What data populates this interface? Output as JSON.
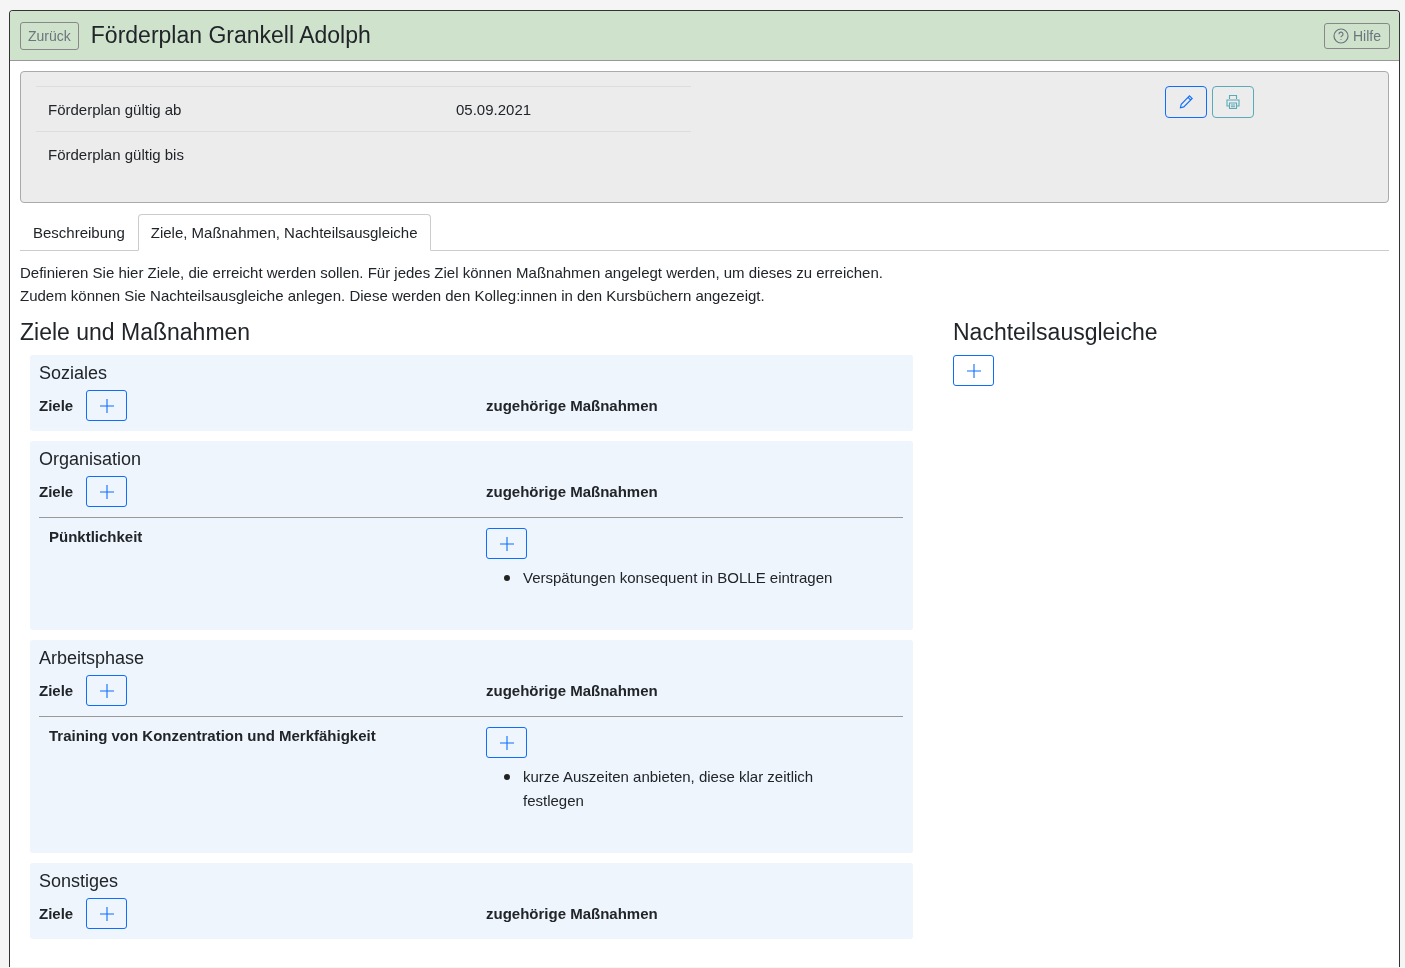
{
  "header": {
    "back_button": "Zurück",
    "title": "Förderplan Grankell Adolph",
    "help_button": "Hilfe"
  },
  "info": {
    "rows": [
      {
        "label": "Förderplan gültig ab",
        "value": "05.09.2021"
      },
      {
        "label": "Förderplan gültig bis"
      }
    ]
  },
  "tabs": [
    {
      "label": "Beschreibung",
      "selected": false
    },
    {
      "label": "Ziele, Maßnahmen, Nachteilsausgleiche",
      "selected": true
    }
  ],
  "intro": [
    "Definieren Sie hier Ziele, die erreicht werden sollen. Für jedes Ziel können Maßnahmen angelegt werden, um dieses zu erreichen.",
    "Zudem können Sie Nachteilsausgleiche anlegen. Diese werden den Kolleg:innen in den Kursbüchern angezeigt."
  ],
  "goals_section": {
    "heading": "Ziele und Maßnahmen",
    "categories": [
      {
        "title": "Soziales",
        "goals_label": "Ziele",
        "measures_label": "zugehörige Maßnahmen"
      },
      {
        "title": "Organisation",
        "goals_label": "Ziele",
        "measures_label": "zugehörige Maßnahmen",
        "goals": [
          {
            "title": "Pünktlichkeit",
            "measures": [
              "Verspätungen konsequent in BOLLE eintragen"
            ]
          }
        ]
      },
      {
        "title": "Arbeitsphase",
        "goals_label": "Ziele",
        "measures_label": "zugehörige Maßnahmen",
        "goals": [
          {
            "title": "Training von Konzentration und Merkfähigkeit",
            "measures": [
              "kurze Auszeiten anbieten, diese klar zeitlich festlegen"
            ]
          }
        ]
      },
      {
        "title": "Sonstiges",
        "goals_label": "Ziele",
        "measures_label": "zugehörige Maßnahmen"
      }
    ]
  },
  "compensations_section": {
    "heading": "Nachteilsausgleiche"
  }
}
